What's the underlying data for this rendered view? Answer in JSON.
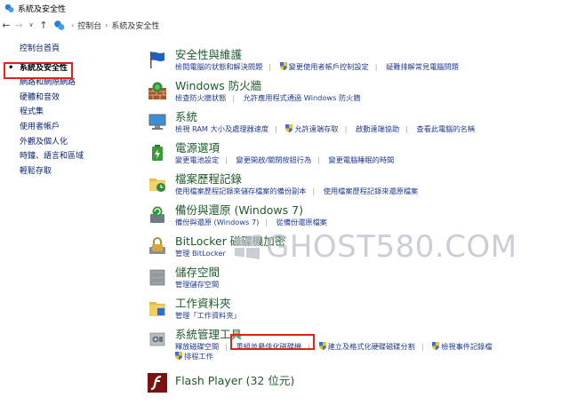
{
  "window": {
    "title": "系統及安全性"
  },
  "address": {
    "crumbs": [
      "控制台",
      "系統及安全性"
    ]
  },
  "sidebar": {
    "home": "控制台首頁",
    "items": [
      "系統及安全性",
      "網路和網際網路",
      "硬體和音效",
      "程式集",
      "使用者帳戶",
      "外觀及個人化",
      "時鐘、語言和區域",
      "輕鬆存取"
    ]
  },
  "categories": [
    {
      "title": "安全性與維護",
      "links": [
        "檢閱電腦的狀態和解決問題",
        "變更使用者帳戶控制設定",
        "疑難排解常見電腦問題"
      ]
    },
    {
      "title": "Windows 防火牆",
      "links": [
        "檢查防火牆狀態",
        "允許應用程式通過 Windows 防火牆"
      ]
    },
    {
      "title": "系統",
      "links": [
        "檢視 RAM 大小及處理器速度",
        "允許遠端存取",
        "啟動遠端協助",
        "查看此電腦的名稱"
      ]
    },
    {
      "title": "電源選項",
      "links": [
        "變更電池設定",
        "變更開啟/關閉按鈕行為",
        "變更電腦睡眠的時間"
      ]
    },
    {
      "title": "檔案歷程記錄",
      "links": [
        "使用檔案歷程記錄來儲存檔案的備份副本",
        "使用檔案歷程記錄來還原檔案"
      ]
    },
    {
      "title": "備份與還原 (Windows 7)",
      "links": [
        "備份與還原 (Windows 7)",
        "從備份還原檔案"
      ]
    },
    {
      "title": "BitLocker 磁碟機加密",
      "links": [
        "管理 BitLocker"
      ]
    },
    {
      "title": "儲存空間",
      "links": [
        "管理儲存空間"
      ]
    },
    {
      "title": "工作資料夾",
      "links": [
        "管理「工作資料夾」"
      ]
    },
    {
      "title": "系統管理工具",
      "links": [
        "釋放磁碟空間",
        "重組並最佳化磁碟機",
        "建立及格式化硬碟磁碟分割",
        "檢視事件記錄檔",
        "排程工作"
      ]
    },
    {
      "title": "Flash Player (32 位元)",
      "links": []
    }
  ],
  "watermark": {
    "text": "GHOST580.COM"
  },
  "colors": {
    "title_green": "#1c5b2a",
    "link_blue": "#243b8c",
    "highlight_red": "#e2231a"
  }
}
